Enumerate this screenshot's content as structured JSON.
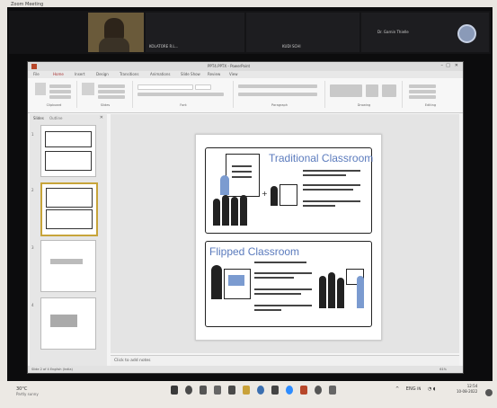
{
  "zoom": {
    "window_title": "Zoom Meeting",
    "participants": [
      {
        "name": "KOLATORE R.L..."
      },
      {
        "name": "KUDI SCHI"
      },
      {
        "name": "Dr. Garnin Thielle"
      }
    ]
  },
  "powerpoint": {
    "title": "PPT4.PPTX - PowerPoint",
    "tabs": [
      "File",
      "Home",
      "Insert",
      "Design",
      "Transitions",
      "Animations",
      "Slide Show",
      "Review",
      "View"
    ],
    "selected_tab": "Home",
    "ribbon_groups": [
      "Clipboard",
      "Slides",
      "Font",
      "Paragraph",
      "Drawing",
      "Editing"
    ],
    "panel_tabs": [
      "Slides",
      "Outline"
    ],
    "thumb_numbers": [
      "1",
      "2",
      "3",
      "4"
    ],
    "notes_placeholder": "Click to add notes",
    "status_left": "Slide 2 of 4   English (India)",
    "status_right": "61%"
  },
  "slide": {
    "title_top": "Traditional Classroom",
    "title_bottom": "Flipped Classroom"
  },
  "taskbar": {
    "weather_temp": "30°C",
    "weather_desc": "Partly sunny",
    "language": "ENG",
    "language_sub": "IN",
    "time": "12:54",
    "date": "10-08-2022"
  },
  "colors": {
    "accent_blue": "#5b7bbd",
    "ppt_red": "#b7472a",
    "monitor_black": "#0c0c0d"
  }
}
